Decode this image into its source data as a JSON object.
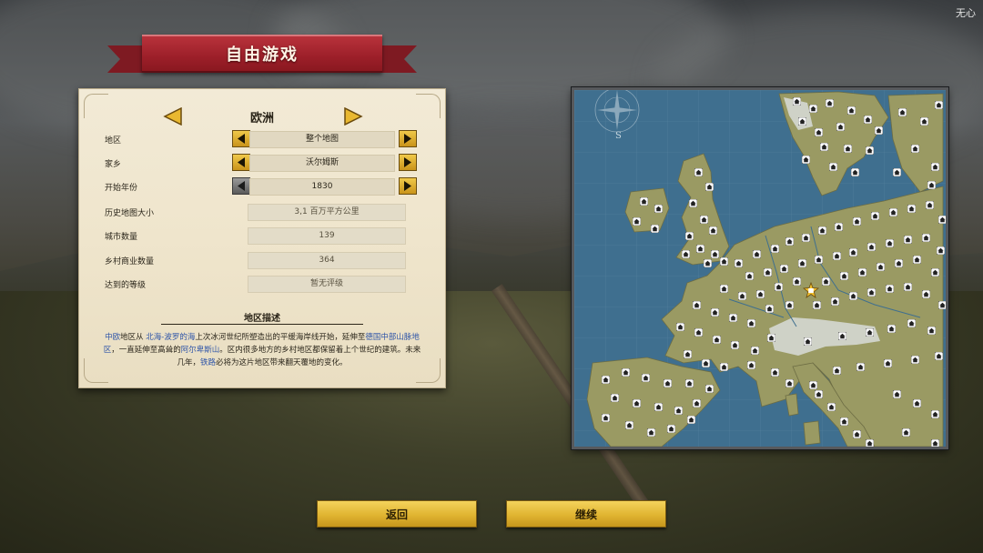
{
  "watermark": "无心",
  "title": "自由游戏",
  "panel": {
    "region_name": "欧洲",
    "rows": [
      {
        "label": "地区",
        "value": "整个地图"
      },
      {
        "label": "家乡",
        "value": "沃尔姆斯"
      },
      {
        "label": "开始年份",
        "value": "1830"
      },
      {
        "label": "历史地图大小",
        "value": "3,1 百万平方公里"
      },
      {
        "label": "城市数量",
        "value": "139"
      },
      {
        "label": "乡村商业数量",
        "value": "364"
      },
      {
        "label": "达到的等级",
        "value": "暂无评级"
      }
    ],
    "description_title": "地区描述",
    "description": {
      "p1": "中欧",
      "p2": "地区从 ",
      "p3": "北海-波罗的海",
      "p4": "上次冰河世纪所塑造出的平缓海岸线开始，延伸至",
      "p5": "德国中部山脉地区",
      "p6": "，一直延伸至高耸的",
      "p7": "阿尔卑斯山",
      "p8": "。区内很多地方的乡村地区都保留着上个世纪的建筑。未来几年，",
      "p9": "铁路",
      "p10": "必将为这片地区带来翻天覆地的变化。"
    }
  },
  "map": {
    "compass_label": "S",
    "hometown_marker": "star-house"
  },
  "buttons": {
    "back": "返回",
    "continue": "继续"
  },
  "colors": {
    "banner_red": "#9c1f29",
    "gold": "#e0b431",
    "link_blue": "#2f55a8",
    "sea": "#3f6f8f",
    "land": "#9a9a63"
  }
}
